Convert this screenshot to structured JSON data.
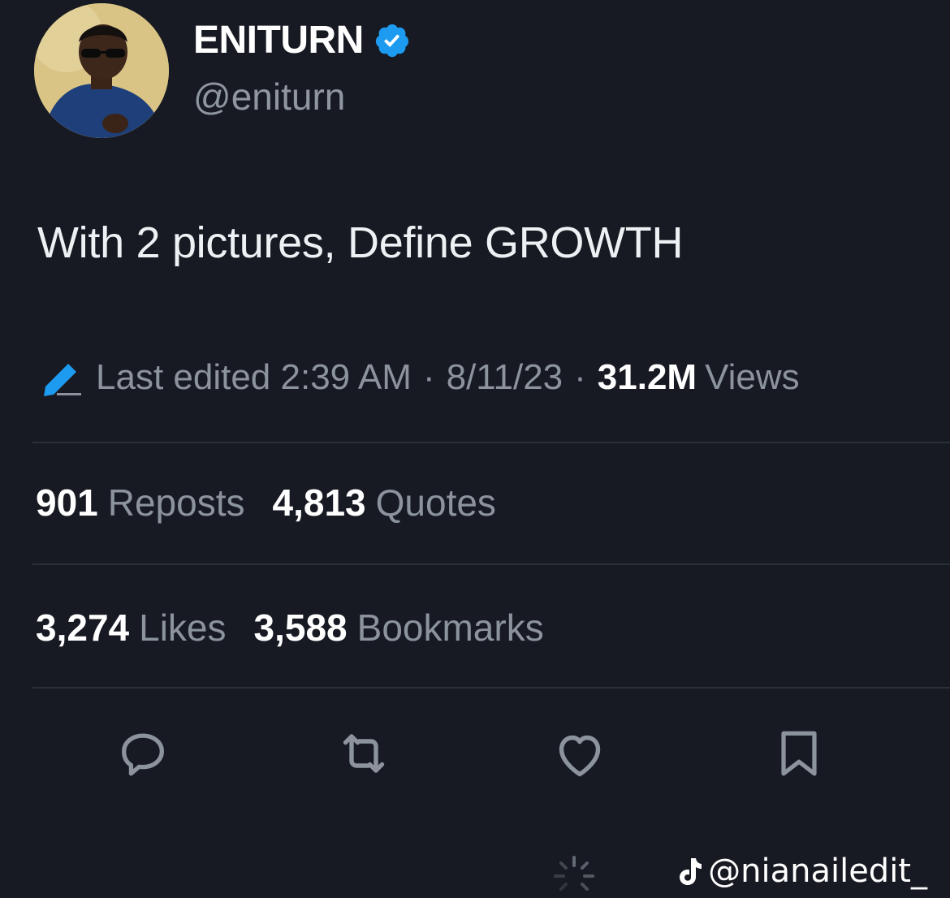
{
  "author": {
    "display_name": "ENITURN",
    "handle": "@eniturn",
    "verified": true,
    "avatar_icon": "profile-photo"
  },
  "tweet": {
    "text": "With 2 pictures, Define GROWTH"
  },
  "meta": {
    "edit_icon": "pencil-edit-icon",
    "edited_label": "Last edited 2:39 AM",
    "separator": "·",
    "date": "8/11/23",
    "views_count": "31.2M",
    "views_label": "Views"
  },
  "stats": {
    "reposts_count": "901",
    "reposts_label": "Reposts",
    "quotes_count": "4,813",
    "quotes_label": "Quotes",
    "likes_count": "3,274",
    "likes_label": "Likes",
    "bookmarks_count": "3,588",
    "bookmarks_label": "Bookmarks"
  },
  "actions": [
    "reply-icon",
    "repost-icon",
    "like-icon",
    "bookmark-icon"
  ],
  "watermark": {
    "icon": "tiktok-icon",
    "text": "@nianailedit_"
  },
  "colors": {
    "background": "#171a22",
    "muted_text": "#8c939d",
    "verified_blue": "#1d9bf0",
    "divider": "#2b2f38"
  }
}
